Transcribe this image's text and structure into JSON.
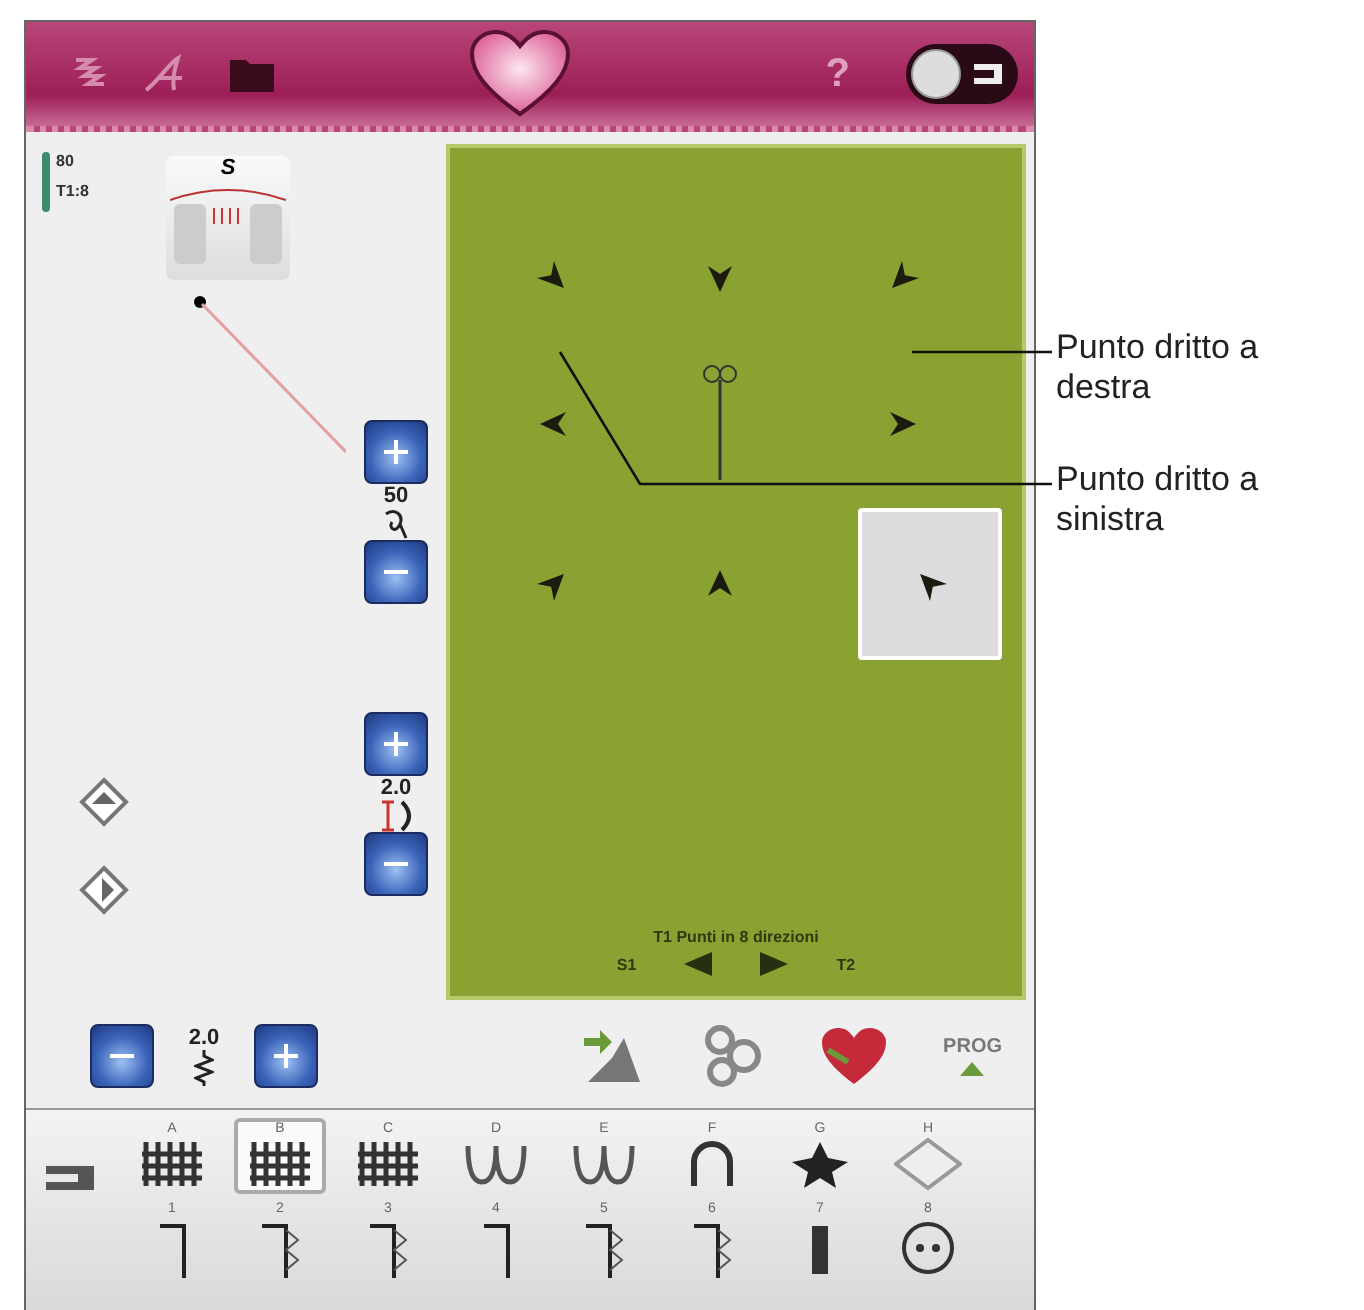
{
  "top_bar": {
    "help": "?",
    "toggle_on": true
  },
  "needle": {
    "size": "80",
    "thread": "T1:8"
  },
  "presser_foot": {
    "label": "S"
  },
  "tension": {
    "value": "50"
  },
  "stitch_width": {
    "value": "2.0"
  },
  "stitch_length": {
    "value": "2.0"
  },
  "direction_panel": {
    "directions": [
      {
        "selected": false
      },
      {
        "selected": false
      },
      {
        "selected": false
      },
      {
        "selected": false
      },
      {
        "selected": false
      },
      {
        "selected": false
      },
      {
        "selected": false
      },
      {
        "selected": true
      }
    ],
    "title": "T1 Punti in 8 direzioni",
    "prev": "S1",
    "next": "T2"
  },
  "program_button": {
    "label": "PROG"
  },
  "stitch_tray": {
    "categories": [
      {
        "label": "A",
        "selected": false
      },
      {
        "label": "B",
        "selected": true
      },
      {
        "label": "C",
        "selected": false
      },
      {
        "label": "D",
        "selected": false
      },
      {
        "label": "E",
        "selected": false
      },
      {
        "label": "F",
        "selected": false
      },
      {
        "label": "G",
        "selected": false
      },
      {
        "label": "H",
        "selected": false
      }
    ],
    "stitches": [
      "1",
      "2",
      "3",
      "4",
      "5",
      "6",
      "7",
      "8"
    ]
  },
  "callouts": [
    {
      "text": "Punto dritto a destra"
    },
    {
      "text": "Punto dritto a sinistra"
    }
  ]
}
